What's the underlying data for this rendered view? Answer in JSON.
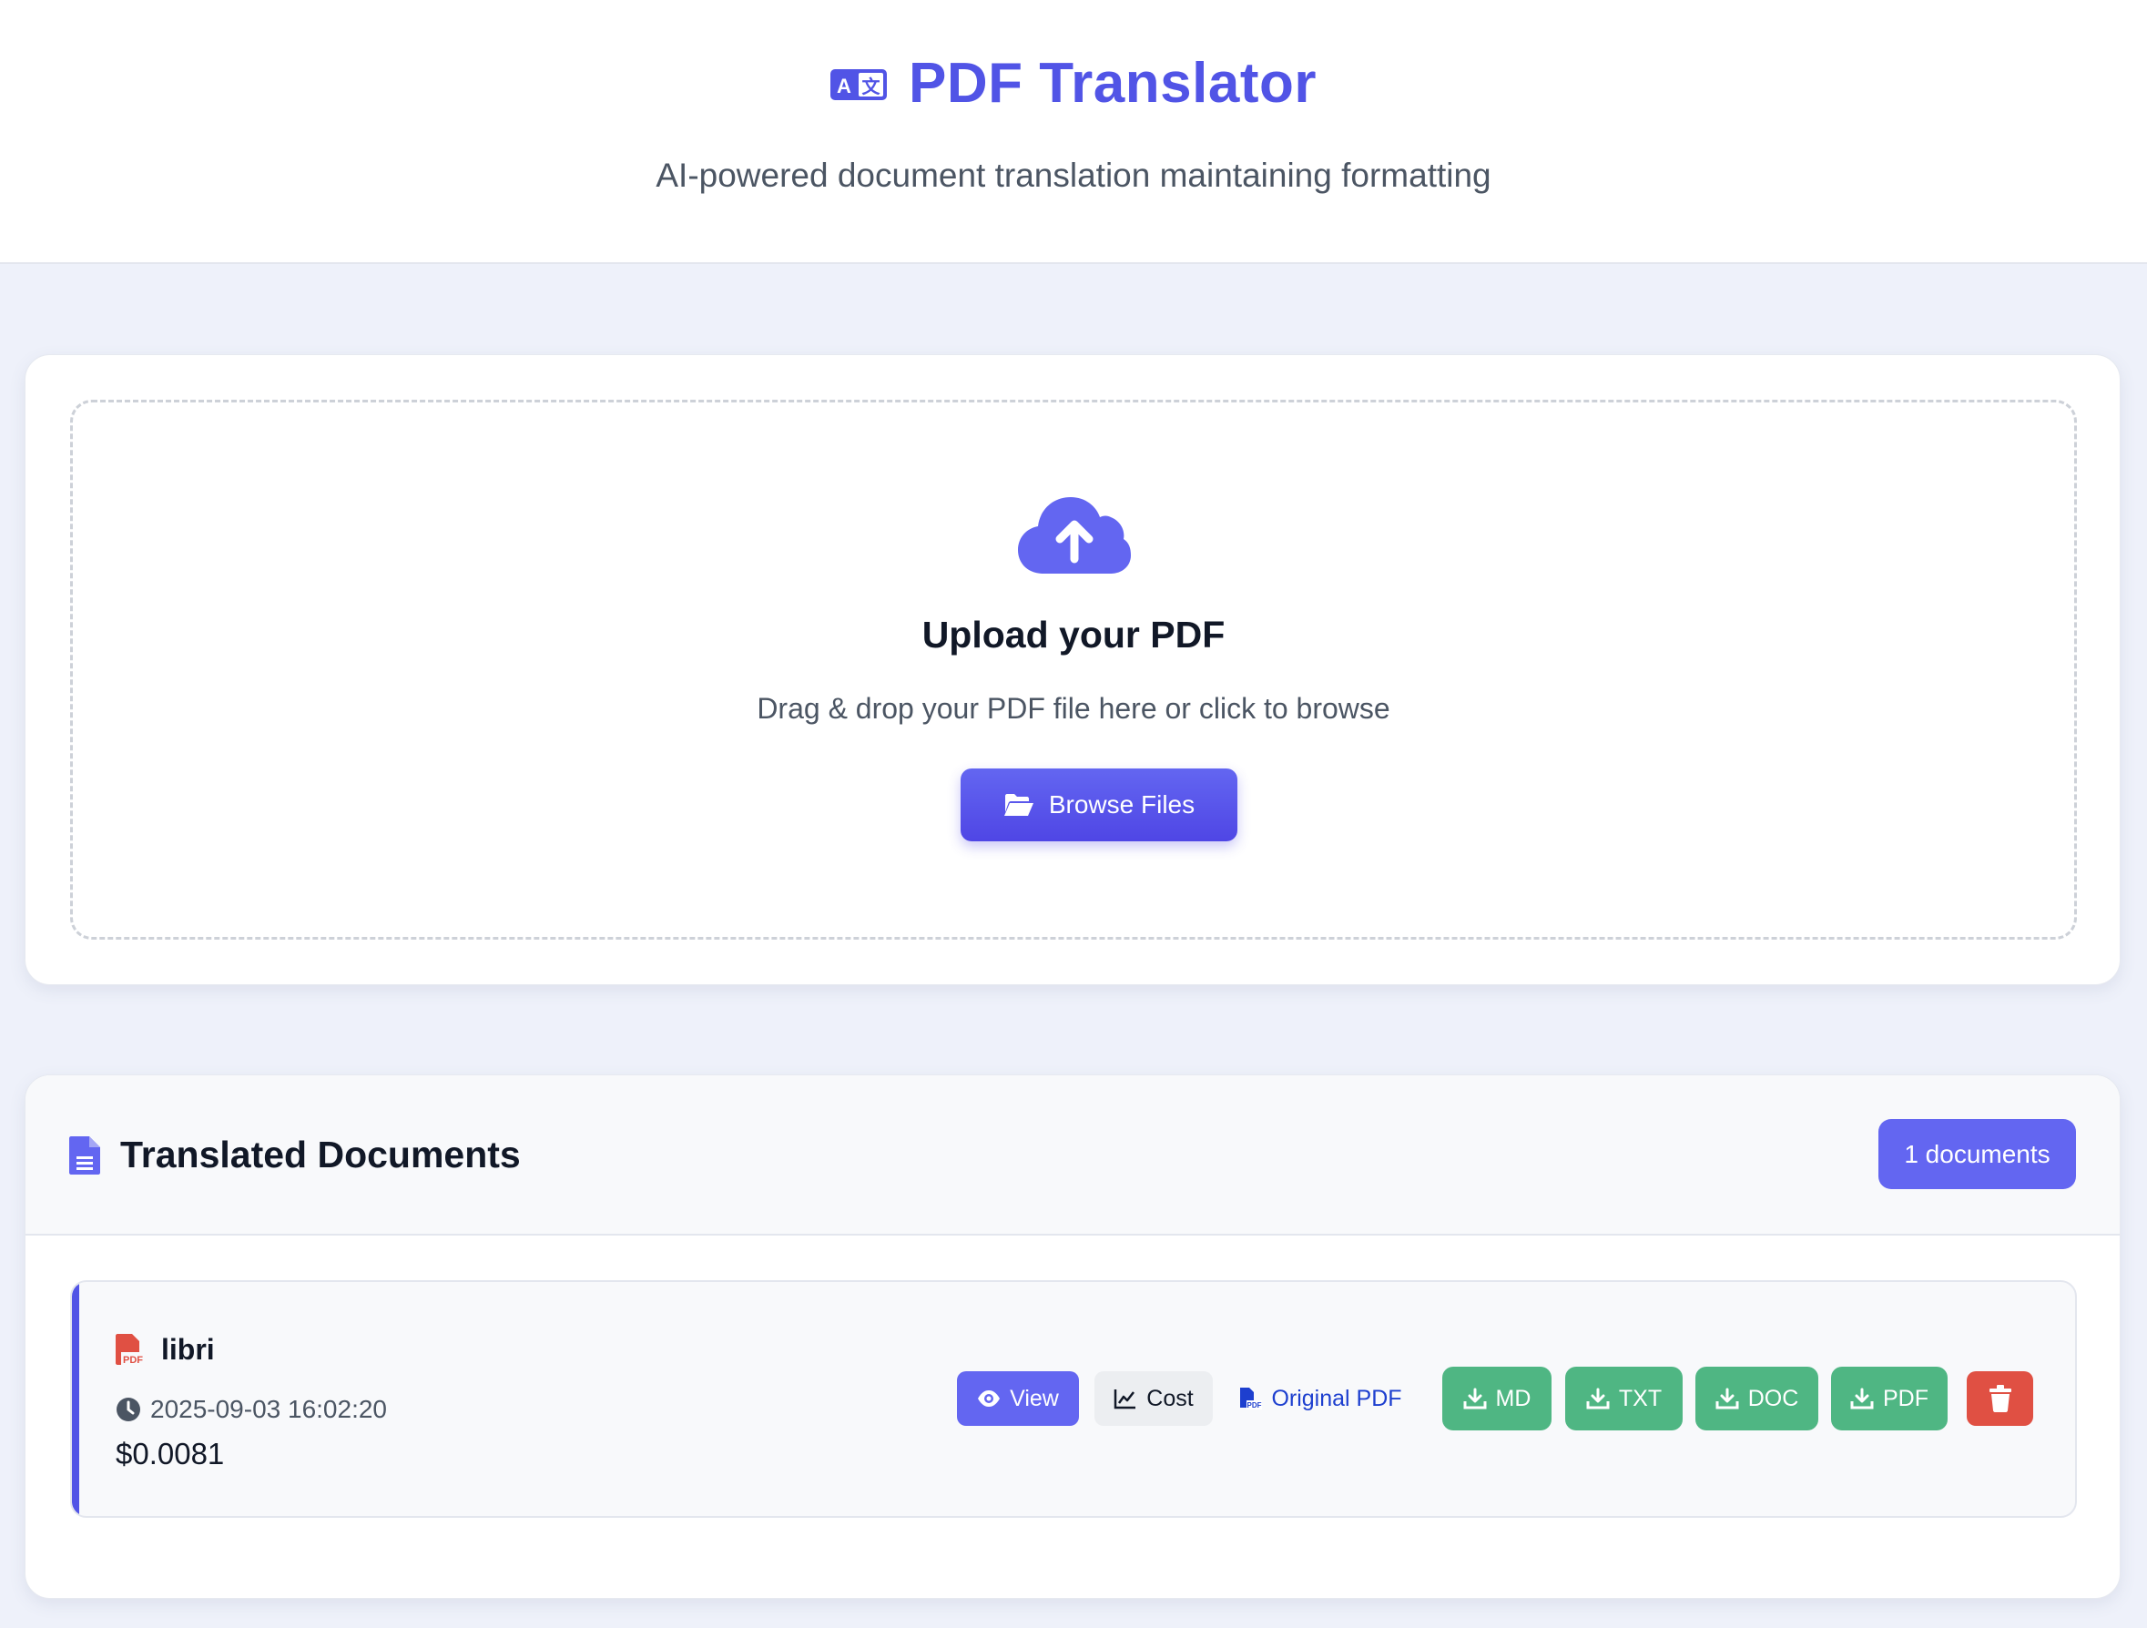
{
  "header": {
    "title": "PDF Translator",
    "subtitle": "AI-powered document translation maintaining formatting",
    "icon": "language-icon",
    "accent_color": "#5154e6"
  },
  "upload": {
    "icon": "cloud-upload-icon",
    "title": "Upload your PDF",
    "subtitle": "Drag & drop your PDF file here or click to browse",
    "browse_label": "Browse Files",
    "browse_icon": "folder-open-icon"
  },
  "documents": {
    "title": "Translated Documents",
    "count_label": "1 documents",
    "items": [
      {
        "name": "libri",
        "timestamp": "2025-09-03 16:02:20",
        "cost": "$0.0081",
        "actions": {
          "view": "View",
          "cost": "Cost",
          "original": "Original PDF",
          "md": "MD",
          "txt": "TXT",
          "doc": "DOC",
          "pdf": "PDF"
        }
      }
    ]
  },
  "colors": {
    "primary": "#6366f1",
    "success": "#4fb683",
    "danger": "#e05043",
    "link": "#1d3fcf",
    "pdf_icon": "#e05043"
  }
}
